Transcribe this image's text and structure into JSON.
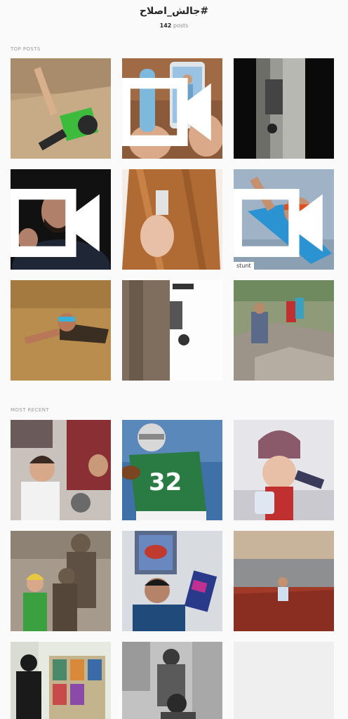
{
  "header": {
    "hashtag": "جالش_اصلاح#",
    "post_count": "142",
    "posts_word": "posts"
  },
  "sections": {
    "top_label": "TOP POSTS",
    "recent_label": "MOST RECENT"
  },
  "top_posts": [
    {
      "id": "top-1",
      "video": false
    },
    {
      "id": "top-2",
      "video": true
    },
    {
      "id": "top-3",
      "video": false
    },
    {
      "id": "top-4",
      "video": true
    },
    {
      "id": "top-5",
      "video": false
    },
    {
      "id": "top-6",
      "video": true,
      "caption": "stunt"
    },
    {
      "id": "top-7",
      "video": false
    },
    {
      "id": "top-8",
      "video": false
    },
    {
      "id": "top-9",
      "video": false
    }
  ],
  "recent_posts": [
    {
      "id": "recent-1"
    },
    {
      "id": "recent-2",
      "jersey": "32"
    },
    {
      "id": "recent-3"
    },
    {
      "id": "recent-4"
    },
    {
      "id": "recent-5"
    },
    {
      "id": "recent-6"
    },
    {
      "id": "recent-7"
    },
    {
      "id": "recent-8"
    }
  ],
  "icons": {
    "video": "video-camera-icon"
  }
}
